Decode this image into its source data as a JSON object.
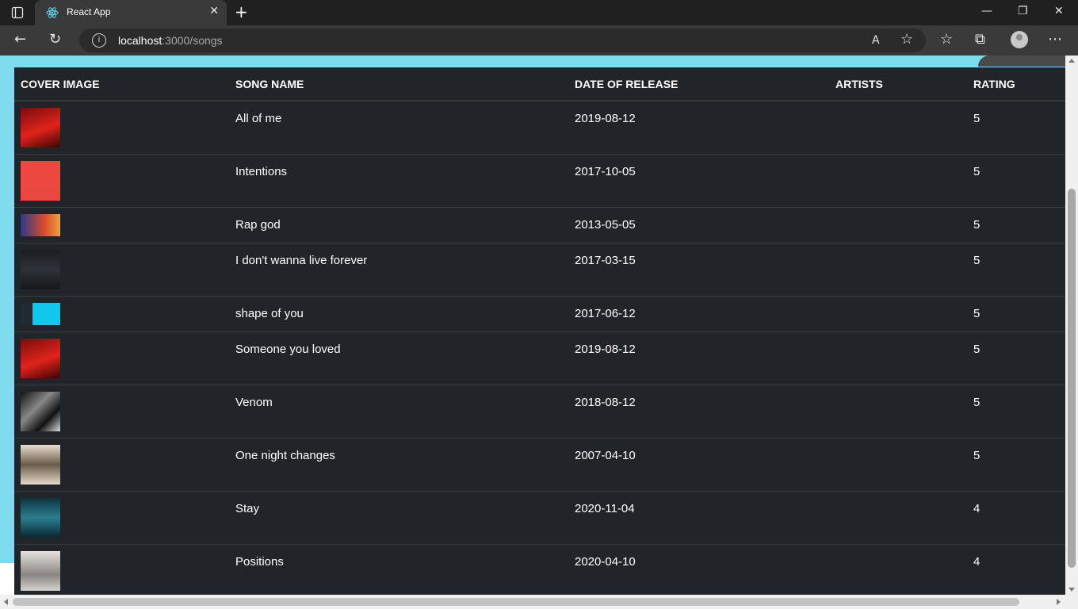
{
  "browser": {
    "tab_title": "React App",
    "url_host": "localhost",
    "url_path": ":3000/songs",
    "accent": "#7fdcef"
  },
  "table": {
    "headers": [
      "COVER IMAGE",
      "SONG NAME",
      "DATE OF RELEASE",
      "ARTISTS",
      "RATING"
    ],
    "rows": [
      {
        "song": "All of me",
        "date": "2019-08-12",
        "artists": "",
        "rating": "5",
        "cover_icon": "album-cover-red"
      },
      {
        "song": "Intentions",
        "date": "2017-10-05",
        "artists": "",
        "rating": "5",
        "cover_icon": "album-cover-pink"
      },
      {
        "song": "Rap god",
        "date": "2013-05-05",
        "artists": "",
        "rating": "5",
        "cover_icon": "album-cover-orange"
      },
      {
        "song": "I don't wanna live forever",
        "date": "2017-03-15",
        "artists": "",
        "rating": "5",
        "cover_icon": "album-cover-dark"
      },
      {
        "song": "shape of you",
        "date": "2017-06-12",
        "artists": "",
        "rating": "5",
        "cover_icon": "album-cover-cyan"
      },
      {
        "song": "Someone you loved",
        "date": "2019-08-12",
        "artists": "",
        "rating": "5",
        "cover_icon": "album-cover-red"
      },
      {
        "song": "Venom",
        "date": "2018-08-12",
        "artists": "",
        "rating": "5",
        "cover_icon": "album-cover-bw"
      },
      {
        "song": "One night changes",
        "date": "2007-04-10",
        "artists": "",
        "rating": "5",
        "cover_icon": "album-cover-beige"
      },
      {
        "song": "Stay",
        "date": "2020-11-04",
        "artists": "",
        "rating": "4",
        "cover_icon": "album-cover-teal"
      },
      {
        "song": "Positions",
        "date": "2020-04-10",
        "artists": "",
        "rating": "4",
        "cover_icon": "album-cover-grey"
      }
    ]
  }
}
